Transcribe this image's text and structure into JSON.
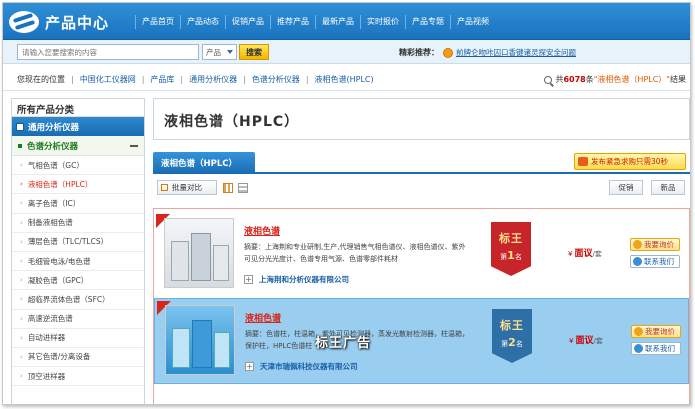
{
  "logo": {
    "text": "产品中心"
  },
  "nav": [
    "产品首页",
    "产品动态",
    "促销产品",
    "推荐产品",
    "最新产品",
    "实时报价",
    "产品专题",
    "产品视频"
  ],
  "search": {
    "placeholder": "请输入您要搜索的内容",
    "select": "产品",
    "button": "搜索"
  },
  "hot": {
    "label": "精彩推荐：",
    "link": "前牌仑吻咔囚口香键诸灵探安全问题"
  },
  "breadcrumb": {
    "location": "您现在的位置",
    "items": [
      "中国化工仪器网",
      "产品库",
      "通用分析仪器",
      "色谱分析仪器",
      "液相色谱(HPLC)"
    ]
  },
  "result": {
    "prefix": "共",
    "count": "6078",
    "middle": "条",
    "keyword": "\"液相色谱（HPLC）\"",
    "suffix": "结果"
  },
  "sidebar": {
    "title": "所有产品分类",
    "category": "通用分析仪器",
    "subcategory": "色谱分析仪器",
    "items": [
      "气相色谱（GC）",
      "液相色谱（HPLC）",
      "离子色谱（IC）",
      "制备液相色谱",
      "薄层色谱（TLC/TLCS）",
      "毛细管电泳/电色谱",
      "凝胶色谱（GPC）",
      "超临界流体色谱（SFC）",
      "高速逆流色谱",
      "自动进样器",
      "其它色谱/分离设备",
      "顶空进样器"
    ],
    "active_index": 1
  },
  "main": {
    "title": "液相色谱（HPLC）",
    "tab": "液相色谱（HPLC）",
    "urgent": "发布紧急求购只需30秒",
    "compare": "批量对比",
    "sort": [
      "促销",
      "新品"
    ]
  },
  "products": [
    {
      "name": "液相色谱",
      "desc": "摘要：上海荆和专业研制,生产,代理销售气相色谱仪、液相色谱仪、紫外可见分光光度计、色谱专用气源、色谱零部件耗材",
      "company": "上海荆和分析仪器有限公司",
      "badge_top": "标王",
      "badge_pre": "第",
      "badge_rank": "1",
      "badge_post": "名",
      "price_symbol": "¥",
      "price": "面议",
      "unit": "/套",
      "ask": "我要询价",
      "contact": "联系我们"
    },
    {
      "name": "液相色谱",
      "desc": "摘要：色谱柱，柱温箱，紫外可见检测器，蒸发光散射检测器，柱温箱，保护柱，HPLC色谱柱",
      "company": "天津市瑞佩科技仪器有限公司",
      "badge_top": "标王",
      "badge_pre": "第",
      "badge_rank": "2",
      "badge_post": "名",
      "price_symbol": "¥",
      "price": "面议",
      "unit": "/套",
      "ask": "我要询价",
      "contact": "联系我们"
    }
  ],
  "overlay_text": "标王广告",
  "colors": {
    "brand_blue": "#1b73bf",
    "accent_red": "#d9261c",
    "price_red": "#cc0000",
    "sub_green": "#1e7a1e"
  }
}
